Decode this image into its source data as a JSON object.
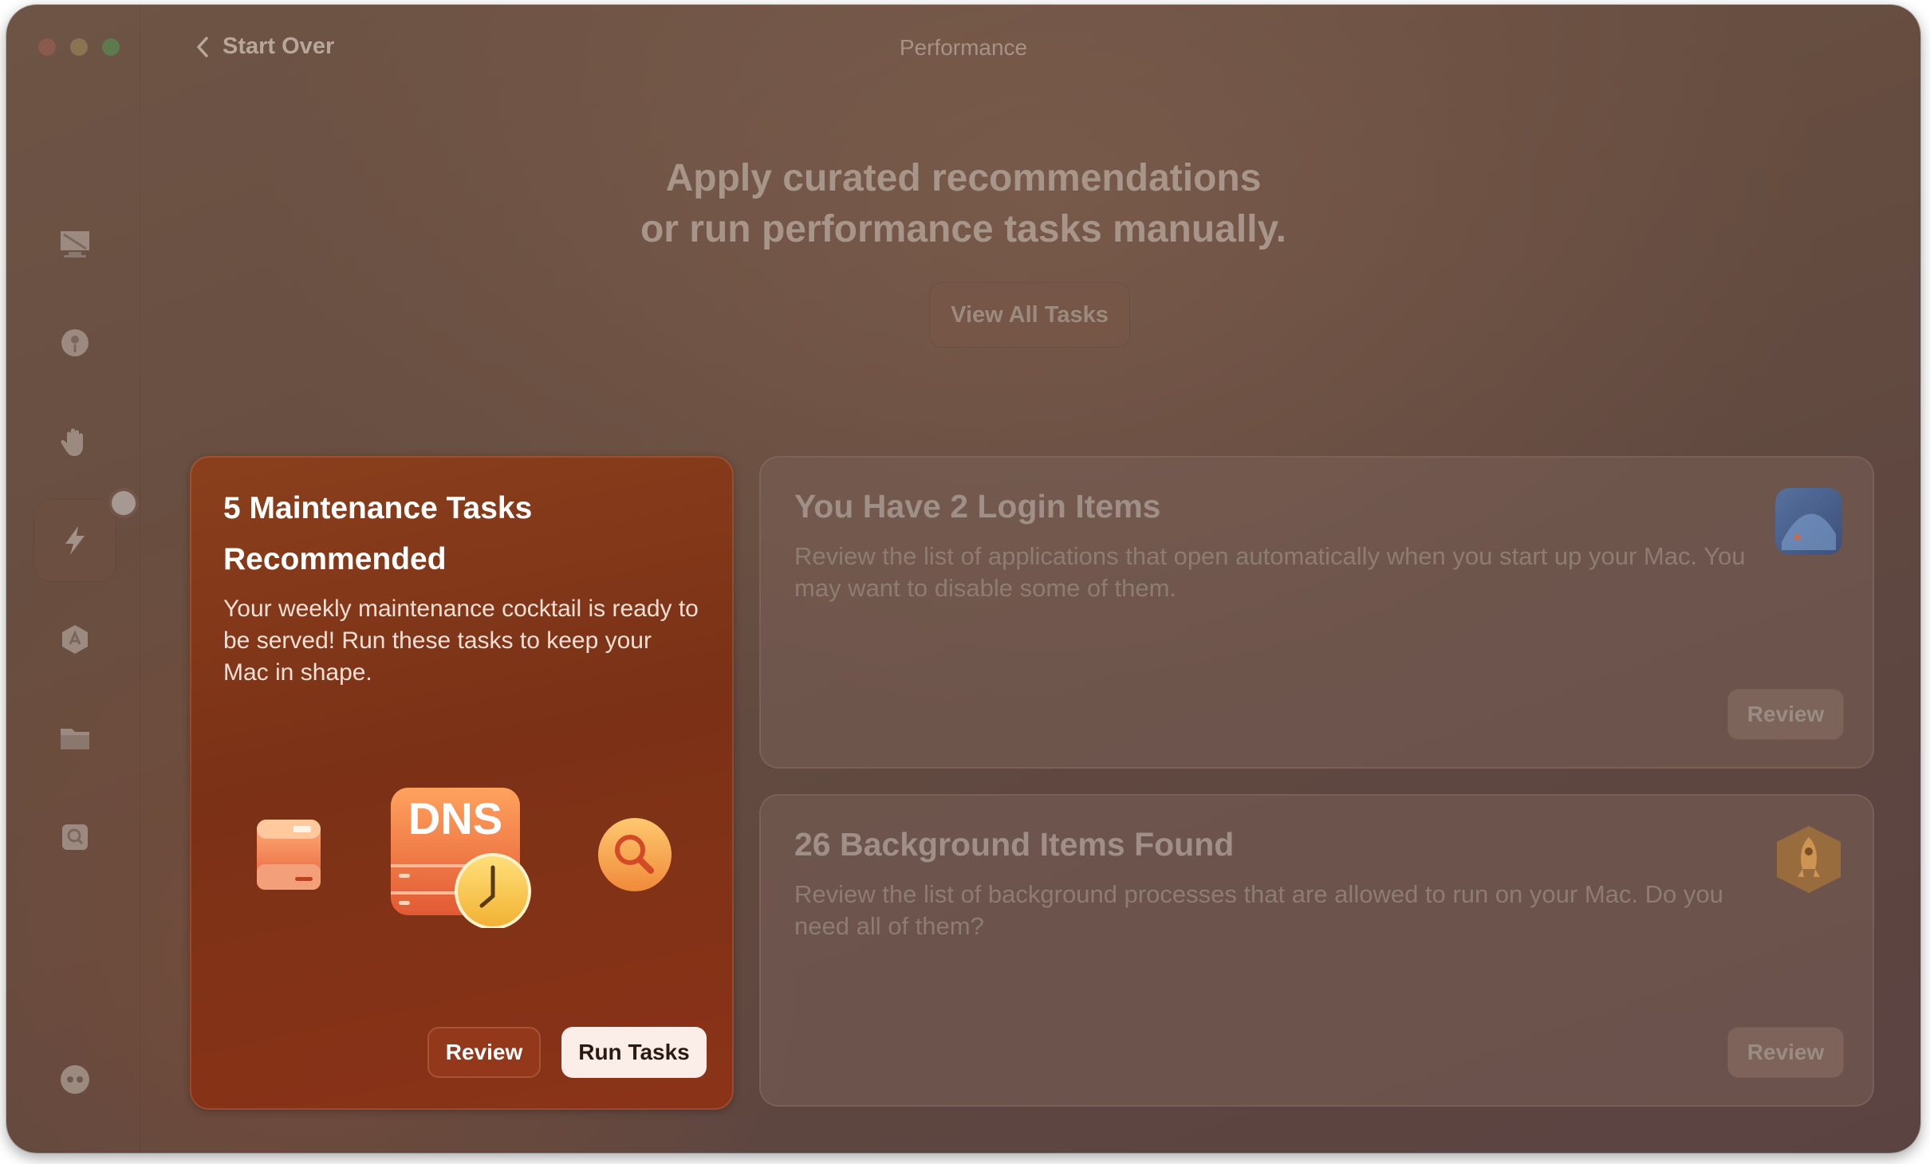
{
  "window": {
    "title": "Performance",
    "back_label": "Start Over"
  },
  "sidebar": {
    "items": [
      {
        "icon": "display-icon"
      },
      {
        "icon": "shield-icon"
      },
      {
        "icon": "hand-icon"
      },
      {
        "icon": "lightning-icon",
        "active": true
      },
      {
        "icon": "apps-icon"
      },
      {
        "icon": "folder-icon"
      },
      {
        "icon": "drive-search-icon"
      }
    ],
    "bottom_icon": "assistant-icon"
  },
  "main": {
    "headline_line1": "Apply curated recommendations",
    "headline_line2": "or run performance tasks manually.",
    "view_all_label": "View All Tasks"
  },
  "cards": {
    "maintenance": {
      "title_line1": "5 Maintenance Tasks",
      "title_line2": "Recommended",
      "description": "Your weekly maintenance cocktail is ready to be served! Run these tasks to keep your Mac in shape.",
      "dns_label": "DNS",
      "review_label": "Review",
      "run_label": "Run Tasks"
    },
    "login_items": {
      "title": "You Have 2 Login Items",
      "description": "Review the list of applications that open automatically when you start up your Mac. You may want to disable some of them.",
      "review_label": "Review"
    },
    "background_items": {
      "title": "26 Background Items Found",
      "description": "Review the list of background processes that are allowed to run on your Mac. Do you need all of them?",
      "review_label": "Review"
    }
  },
  "colors": {
    "accent_card": "#7b3116",
    "button_light": "#fbeee8",
    "dns_orange": "#f07a3c",
    "clock_yellow": "#f6c443"
  }
}
